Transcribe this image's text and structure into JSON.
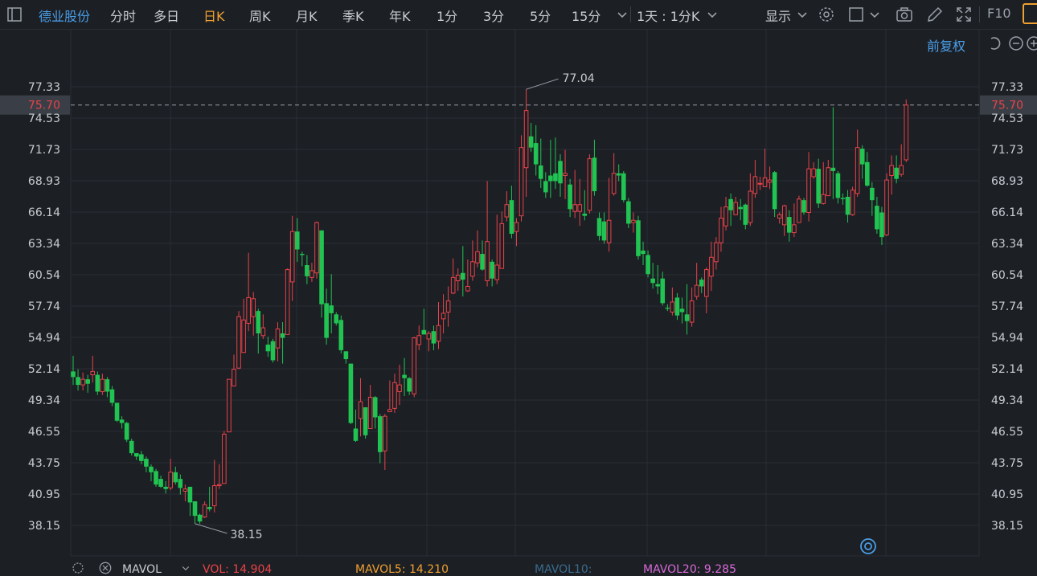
{
  "toolbar": {
    "stock_name": "德业股份",
    "periods": [
      "分时",
      "多日",
      "日K",
      "周K",
      "月K",
      "季K",
      "年K",
      "1分",
      "3分",
      "5分",
      "15分"
    ],
    "active_period": "日K",
    "minute_mode": "1天 : 1分K",
    "display": "显示",
    "f10": "F10"
  },
  "sub": {
    "adjust": "前复权"
  },
  "colors": {
    "up": "#e8434a",
    "down": "#21c452",
    "bg": "#1c1f24",
    "grid": "#2a2e35",
    "accent": "#f0a030",
    "link": "#4a9ee8"
  },
  "chart_data": {
    "type": "candlestick",
    "y_ticks": [
      "77.33",
      "74.53",
      "71.73",
      "68.93",
      "66.14",
      "63.34",
      "60.54",
      "57.74",
      "54.94",
      "52.14",
      "49.34",
      "46.55",
      "43.75",
      "40.95",
      "38.15"
    ],
    "ylim": [
      38.15,
      77.33
    ],
    "current_price": "75.70",
    "high_label": "77.04",
    "low_label": "38.15",
    "candles": [
      [
        51.9,
        51.4,
        53.3,
        50.7
      ],
      [
        51.4,
        50.7,
        52.1,
        50.2
      ],
      [
        50.7,
        51.2,
        51.8,
        50.2
      ],
      [
        51.2,
        50.8,
        51.6,
        50.0
      ],
      [
        51.6,
        51.9,
        53.3,
        50.9
      ],
      [
        51.6,
        50.1,
        51.9,
        49.8
      ],
      [
        50.1,
        51.2,
        51.7,
        49.8
      ],
      [
        51.2,
        50.1,
        51.4,
        49.6
      ],
      [
        50.3,
        49.1,
        50.6,
        48.8
      ],
      [
        49.1,
        47.5,
        49.1,
        47.4
      ],
      [
        47.6,
        47.3,
        47.9,
        46.8
      ],
      [
        47.3,
        45.8,
        47.4,
        45.6
      ],
      [
        45.7,
        44.6,
        45.9,
        44.4
      ],
      [
        44.6,
        44.3,
        44.6,
        44.0
      ],
      [
        44.5,
        43.9,
        44.8,
        43.6
      ],
      [
        44.1,
        43.4,
        44.3,
        42.9
      ],
      [
        43.4,
        42.9,
        43.6,
        42.1
      ],
      [
        43.0,
        41.8,
        43.2,
        41.6
      ],
      [
        42.3,
        41.6,
        42.6,
        41.5
      ],
      [
        41.6,
        41.4,
        42.1,
        41.0
      ],
      [
        41.5,
        42.9,
        44.1,
        41.3
      ],
      [
        42.9,
        42.0,
        43.4,
        41.8
      ],
      [
        42.3,
        41.5,
        42.7,
        40.9
      ],
      [
        41.2,
        41.4,
        41.8,
        40.3
      ],
      [
        41.6,
        40.2,
        41.6,
        39.0
      ],
      [
        40.3,
        39.0,
        40.3,
        38.3
      ],
      [
        39.1,
        38.5,
        39.2,
        38.3
      ],
      [
        38.9,
        40.0,
        40.3,
        38.8
      ],
      [
        39.8,
        39.6,
        41.6,
        39.4
      ],
      [
        39.9,
        41.7,
        44.0,
        39.3
      ],
      [
        41.7,
        41.8,
        43.6,
        41.4
      ],
      [
        41.9,
        46.3,
        46.6,
        41.9
      ],
      [
        46.5,
        51.2,
        51.2,
        46.5
      ],
      [
        50.6,
        52.1,
        53.4,
        50.7
      ],
      [
        52.2,
        56.8,
        57.3,
        52.1
      ],
      [
        53.6,
        56.5,
        58.4,
        53.8
      ],
      [
        56.2,
        58.5,
        62.5,
        55.5
      ],
      [
        56.8,
        58.4,
        59.0,
        55.1
      ],
      [
        57.3,
        55.3,
        57.5,
        53.5
      ],
      [
        55.1,
        55.8,
        57.0,
        54.8
      ],
      [
        54.3,
        53.7,
        55.0,
        53.2
      ],
      [
        54.6,
        52.9,
        54.8,
        52.7
      ],
      [
        54.0,
        55.7,
        56.3,
        52.8
      ],
      [
        55.3,
        54.9,
        56.3,
        52.6
      ],
      [
        55.2,
        61.0,
        61.1,
        55.2
      ],
      [
        59.9,
        64.4,
        65.8,
        58.2
      ],
      [
        64.4,
        62.8,
        65.6,
        61.7
      ],
      [
        62.4,
        62.3,
        62.6,
        61.3
      ],
      [
        61.4,
        60.4,
        62.3,
        59.7
      ],
      [
        60.3,
        60.9,
        61.6,
        59.9
      ],
      [
        60.7,
        65.2,
        65.3,
        60.2
      ],
      [
        64.5,
        57.9,
        64.5,
        56.7
      ],
      [
        58.0,
        54.9,
        59.3,
        54.3
      ],
      [
        57.8,
        57.1,
        60.6,
        55.3
      ],
      [
        57.0,
        56.2,
        57.2,
        56.0
      ],
      [
        56.5,
        53.8,
        56.9,
        53.5
      ],
      [
        53.7,
        53.0,
        53.7,
        52.6
      ],
      [
        52.6,
        47.3,
        52.6,
        47.2
      ],
      [
        46.8,
        45.7,
        48.5,
        45.6
      ],
      [
        47.7,
        49.2,
        51.3,
        46.1
      ],
      [
        48.7,
        46.2,
        48.7,
        45.9
      ],
      [
        46.8,
        49.6,
        50.7,
        47.0
      ],
      [
        49.6,
        47.8,
        49.7,
        46.8
      ],
      [
        47.9,
        44.7,
        48.1,
        43.7
      ],
      [
        44.8,
        47.9,
        48.1,
        43.1
      ],
      [
        48.3,
        48.5,
        51.1,
        48.3
      ],
      [
        48.6,
        50.9,
        51.7,
        48.2
      ],
      [
        50.1,
        50.7,
        52.5,
        48.9
      ],
      [
        51.6,
        51.3,
        53.1,
        49.7
      ],
      [
        51.3,
        50.1,
        51.4,
        49.8
      ],
      [
        49.9,
        54.9,
        55.0,
        49.6
      ],
      [
        54.3,
        55.1,
        56.0,
        53.8
      ],
      [
        55.6,
        55.2,
        57.5,
        55.3
      ],
      [
        54.8,
        55.3,
        55.5,
        53.7
      ],
      [
        55.5,
        54.4,
        56.0,
        53.8
      ],
      [
        54.6,
        56.0,
        58.1,
        53.9
      ],
      [
        56.6,
        57.1,
        58.8,
        55.3
      ],
      [
        57.2,
        58.2,
        59.5,
        55.9
      ],
      [
        58.9,
        60.3,
        62.0,
        58.8
      ],
      [
        60.0,
        60.5,
        61.1,
        59.1
      ],
      [
        60.7,
        60.1,
        63.1,
        58.6
      ],
      [
        59.1,
        59.5,
        61.9,
        59.0
      ],
      [
        60.4,
        61.7,
        63.6,
        60.0
      ],
      [
        61.6,
        62.6,
        64.5,
        61.2
      ],
      [
        62.4,
        61.0,
        63.6,
        60.9
      ],
      [
        60.0,
        63.5,
        68.9,
        59.5
      ],
      [
        61.7,
        60.2,
        61.9,
        59.5
      ],
      [
        60.1,
        61.4,
        65.9,
        59.7
      ],
      [
        61.1,
        65.1,
        66.2,
        61.1
      ],
      [
        65.7,
        66.8,
        68.0,
        65.3
      ],
      [
        67.2,
        64.2,
        68.5,
        63.8
      ],
      [
        64.4,
        65.2,
        65.6,
        63.1
      ],
      [
        65.8,
        71.9,
        73.0,
        65.3
      ],
      [
        70.1,
        75.2,
        77.1,
        67.5
      ],
      [
        72.9,
        71.9,
        74.1,
        71.5
      ],
      [
        72.3,
        70.4,
        73.9,
        69.4
      ],
      [
        70.3,
        69.1,
        72.7,
        68.3
      ],
      [
        68.9,
        67.9,
        69.7,
        67.4
      ],
      [
        69.4,
        68.9,
        72.6,
        67.4
      ],
      [
        69.6,
        68.9,
        72.8,
        68.2
      ],
      [
        70.7,
        68.7,
        71.3,
        67.5
      ],
      [
        69.4,
        69.6,
        71.7,
        67.3
      ],
      [
        68.6,
        66.4,
        69.1,
        65.7
      ],
      [
        66.2,
        66.8,
        69.9,
        65.6
      ],
      [
        66.2,
        66.8,
        69.1,
        64.9
      ],
      [
        66.0,
        65.8,
        68.1,
        65.4
      ],
      [
        66.3,
        70.9,
        71.3,
        66.0
      ],
      [
        71.0,
        68.0,
        72.6,
        67.6
      ],
      [
        65.6,
        64.0,
        66.1,
        63.6
      ],
      [
        65.3,
        63.6,
        66.1,
        63.3
      ],
      [
        63.4,
        65.4,
        69.2,
        62.6
      ],
      [
        67.8,
        69.6,
        71.4,
        67.6
      ],
      [
        69.6,
        69.4,
        70.4,
        68.9
      ],
      [
        69.6,
        67.2,
        69.8,
        67.0
      ],
      [
        67.1,
        65.1,
        67.4,
        64.7
      ],
      [
        65.2,
        65.4,
        66.1,
        64.3
      ],
      [
        65.4,
        62.2,
        65.8,
        61.9
      ],
      [
        62.7,
        62.4,
        63.5,
        61.4
      ],
      [
        62.3,
        60.6,
        62.7,
        60.3
      ],
      [
        60.2,
        59.8,
        61.6,
        59.3
      ],
      [
        59.7,
        59.5,
        61.4,
        58.8
      ],
      [
        60.2,
        58.0,
        60.8,
        57.8
      ],
      [
        57.6,
        57.5,
        57.9,
        57.3
      ],
      [
        57.2,
        58.1,
        59.4,
        56.9
      ],
      [
        58.5,
        56.9,
        58.9,
        56.5
      ],
      [
        57.5,
        57.2,
        58.5,
        56.2
      ],
      [
        57.0,
        56.4,
        59.7,
        55.2
      ],
      [
        56.3,
        58.2,
        59.4,
        55.9
      ],
      [
        58.6,
        59.6,
        61.6,
        58.3
      ],
      [
        60.1,
        59.5,
        60.3,
        58.9
      ],
      [
        58.6,
        61.0,
        61.2,
        57.1
      ],
      [
        60.4,
        62.1,
        63.5,
        59.1
      ],
      [
        61.7,
        63.4,
        63.9,
        61.0
      ],
      [
        63.4,
        65.6,
        66.6,
        62.6
      ],
      [
        64.9,
        66.6,
        67.5,
        64.5
      ],
      [
        67.3,
        66.3,
        67.8,
        64.9
      ],
      [
        65.9,
        67.0,
        67.5,
        66.1
      ],
      [
        66.6,
        66.4,
        67.3,
        65.4
      ],
      [
        66.8,
        65.0,
        66.9,
        64.6
      ],
      [
        65.2,
        68.0,
        69.6,
        64.9
      ],
      [
        67.8,
        69.3,
        70.8,
        67.4
      ],
      [
        68.7,
        68.7,
        69.3,
        68.1
      ],
      [
        68.4,
        69.2,
        71.8,
        68.5
      ],
      [
        68.8,
        69.0,
        70.2,
        68.2
      ],
      [
        69.7,
        66.4,
        69.8,
        65.7
      ],
      [
        65.6,
        65.9,
        66.1,
        65.1
      ],
      [
        65.0,
        66.7,
        66.8,
        64.0
      ],
      [
        65.7,
        64.3,
        66.3,
        63.5
      ],
      [
        64.3,
        65.0,
        66.9,
        63.9
      ],
      [
        65.2,
        67.3,
        67.6,
        65.8
      ],
      [
        67.2,
        66.1,
        67.4,
        65.9
      ],
      [
        66.1,
        70.0,
        71.5,
        65.3
      ],
      [
        69.3,
        70.0,
        70.6,
        69.1
      ],
      [
        70.0,
        66.9,
        70.9,
        66.5
      ],
      [
        66.9,
        67.7,
        70.6,
        66.8
      ],
      [
        67.6,
        70.1,
        70.8,
        67.6
      ],
      [
        70.1,
        69.8,
        75.5,
        67.3
      ],
      [
        69.6,
        67.4,
        69.8,
        66.9
      ],
      [
        67.4,
        67.3,
        67.8,
        66.8
      ],
      [
        67.5,
        65.9,
        68.1,
        65.2
      ],
      [
        65.9,
        68.1,
        68.4,
        65.8
      ],
      [
        67.8,
        71.9,
        73.5,
        67.5
      ],
      [
        71.8,
        70.4,
        72.1,
        69.1
      ],
      [
        70.6,
        68.5,
        71.5,
        68.4
      ],
      [
        68.3,
        67.2,
        68.8,
        65.8
      ],
      [
        66.7,
        64.6,
        67.5,
        64.2
      ],
      [
        66.1,
        63.9,
        66.6,
        63.2
      ],
      [
        64.1,
        69.0,
        69.6,
        64.0
      ],
      [
        69.4,
        70.3,
        71.2,
        67.7
      ],
      [
        70.1,
        69.1,
        71.2,
        68.7
      ],
      [
        69.5,
        70.3,
        72.2,
        69.3
      ],
      [
        70.8,
        75.7,
        76.2,
        70.6
      ]
    ]
  },
  "bottom": {
    "mavol": "MAVOL",
    "vol": "VOL: 14.904",
    "mavol5": "MAVOL5: 14.210",
    "mavol10": "MAVOL10:",
    "mavol20": "MAVOL20: 9.285"
  }
}
